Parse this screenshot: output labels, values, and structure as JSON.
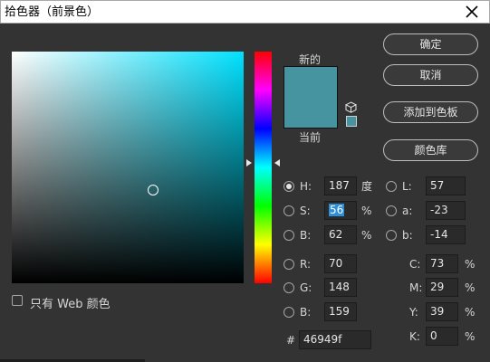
{
  "window": {
    "title": "拾色器（前景色）"
  },
  "preview": {
    "new_label": "新的",
    "current_label": "当前",
    "new_color": "#46949f",
    "current_color": "#46949f"
  },
  "buttons": {
    "ok": "确定",
    "cancel": "取消",
    "add_to_swatches": "添加到色板",
    "color_libraries": "颜色库"
  },
  "fields": {
    "hsb": [
      {
        "label": "H:",
        "value": "187",
        "unit": "度",
        "selected": true
      },
      {
        "label": "S:",
        "value": "56",
        "unit": "%",
        "selected": false
      },
      {
        "label": "B:",
        "value": "62",
        "unit": "%",
        "selected": false
      }
    ],
    "rgb": [
      {
        "label": "R:",
        "value": "70"
      },
      {
        "label": "G:",
        "value": "148"
      },
      {
        "label": "B:",
        "value": "159"
      }
    ],
    "lab": [
      {
        "label": "L:",
        "value": "57"
      },
      {
        "label": "a:",
        "value": "-23"
      },
      {
        "label": "b:",
        "value": "-14"
      }
    ],
    "cmyk": [
      {
        "label": "C:",
        "value": "73",
        "unit": "%"
      },
      {
        "label": "M:",
        "value": "29",
        "unit": "%"
      },
      {
        "label": "Y:",
        "value": "39",
        "unit": "%"
      },
      {
        "label": "K:",
        "value": "0",
        "unit": "%"
      }
    ],
    "hex_label": "#",
    "hex_value": "46949f"
  },
  "web_only": {
    "label": "只有 Web 颜色",
    "checked": false
  },
  "colors": {
    "panel_bg": "#333333",
    "hue_pure": "#00e1ff",
    "selection": "#2c8fd8"
  },
  "icons": {
    "close": "close-icon",
    "gamut_cube": "cube-icon"
  }
}
